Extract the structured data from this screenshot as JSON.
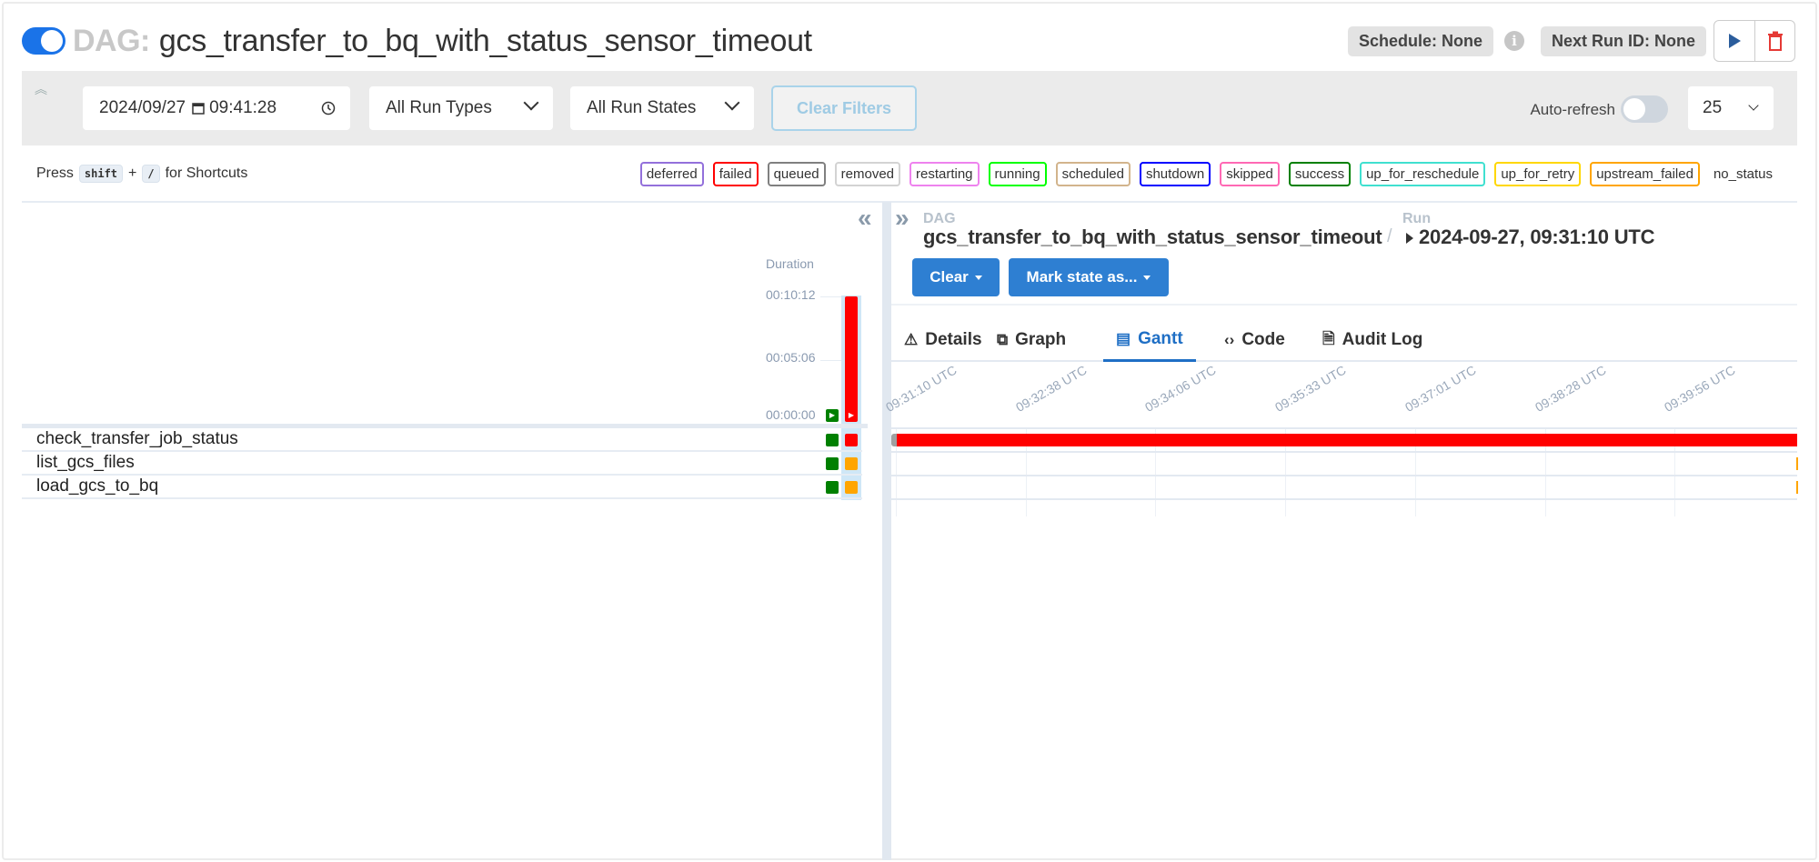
{
  "header": {
    "dag_prefix": "DAG:",
    "dag_id": "gcs_transfer_to_bq_with_status_sensor_timeout",
    "paused": false,
    "schedule": "Schedule: None",
    "next_run": "Next Run ID: None",
    "info_icon": "i",
    "play_icon": "play-icon",
    "delete_icon": "trash-icon"
  },
  "filters": {
    "collapse_icon": "double-chevron-up-icon",
    "date": "2024/09/27",
    "time": "09:41:28",
    "run_types": "All Run Types",
    "run_states": "All Run States",
    "clear_filters": "Clear Filters",
    "auto_refresh_label": "Auto-refresh",
    "auto_refresh_on": false,
    "page_size": "25"
  },
  "shortcuts": {
    "press": "Press",
    "key1": "shift",
    "plus": "+",
    "key2": "/",
    "suffix": "for Shortcuts"
  },
  "legend": [
    {
      "label": "deferred",
      "color": "#9370db"
    },
    {
      "label": "failed",
      "color": "#ff0000"
    },
    {
      "label": "queued",
      "color": "#808080"
    },
    {
      "label": "removed",
      "color": "#d3d3d3"
    },
    {
      "label": "restarting",
      "color": "#ee82ee"
    },
    {
      "label": "running",
      "color": "#00ff00"
    },
    {
      "label": "scheduled",
      "color": "#d2b48c"
    },
    {
      "label": "shutdown",
      "color": "#0000ff"
    },
    {
      "label": "skipped",
      "color": "#ff69b4"
    },
    {
      "label": "success",
      "color": "#008000"
    },
    {
      "label": "up_for_reschedule",
      "color": "#40e0d0"
    },
    {
      "label": "up_for_retry",
      "color": "#ffd700"
    },
    {
      "label": "upstream_failed",
      "color": "#ffa500"
    },
    {
      "label": "no_status",
      "color": "transparent"
    }
  ],
  "grid": {
    "duration_label": "Duration",
    "duration_ticks": [
      "00:10:12",
      "00:05:06",
      "00:00:00"
    ],
    "runs": [
      {
        "state": "success",
        "color": "#008000",
        "duration_fraction": 0.0
      },
      {
        "state": "failed",
        "color": "#ff0000",
        "duration_fraction": 1.0
      }
    ],
    "tasks": [
      {
        "name": "check_transfer_job_status",
        "states": [
          "#008000",
          "#ff0000"
        ]
      },
      {
        "name": "list_gcs_files",
        "states": [
          "#008000",
          "#ffa500"
        ]
      },
      {
        "name": "load_gcs_to_bq",
        "states": [
          "#008000",
          "#ffa500"
        ]
      }
    ]
  },
  "details": {
    "dag_label": "DAG",
    "dag_id": "gcs_transfer_to_bq_with_status_sensor_timeout",
    "separator": "/",
    "run_label": "Run",
    "run_id": "2024-09-27, 09:31:10 UTC",
    "clear_button": "Clear",
    "mark_state_button": "Mark state as...",
    "tabs": [
      {
        "label": "Details",
        "icon": "⚠"
      },
      {
        "label": "Graph",
        "icon": "⧉"
      },
      {
        "label": "Gantt",
        "icon": "▤",
        "active": true
      },
      {
        "label": "Code",
        "icon": "‹›"
      },
      {
        "label": "Audit Log",
        "icon": "🗎"
      }
    ]
  },
  "gantt": {
    "ticks": [
      "09:31:10 UTC",
      "09:32:38 UTC",
      "09:34:06 UTC",
      "09:35:33 UTC",
      "09:37:01 UTC",
      "09:38:28 UTC",
      "09:39:56 UTC"
    ],
    "bars": [
      {
        "task": "check_transfer_job_status",
        "state": "failed",
        "color": "#ff0000",
        "queued_color": "#a0a0a0",
        "start_fraction": 0.006,
        "end_fraction": 1.0
      },
      {
        "task": "list_gcs_files",
        "state": "upstream_failed",
        "color": "#ffa500",
        "start_fraction": 0.999,
        "end_fraction": 1.0
      },
      {
        "task": "load_gcs_to_bq",
        "state": "upstream_failed",
        "color": "#ffa500",
        "start_fraction": 0.999,
        "end_fraction": 1.0
      }
    ]
  }
}
